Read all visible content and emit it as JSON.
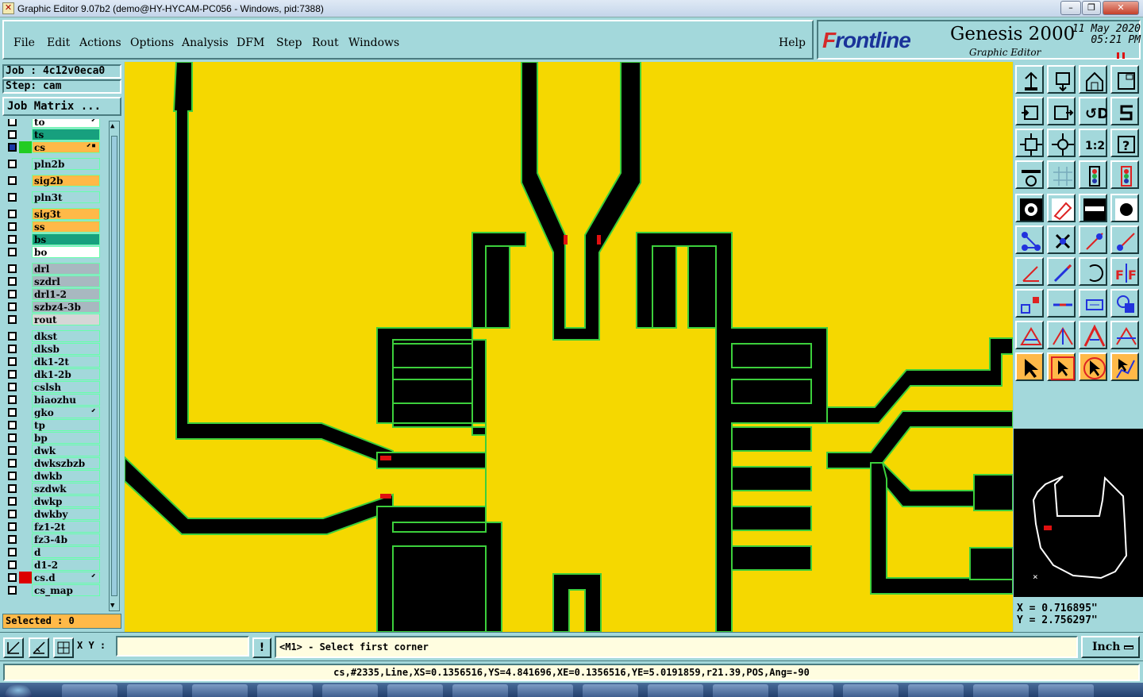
{
  "window": {
    "title": "Graphic Editor 9.07b2 (demo@HY-HYCAM-PC056 - Windows, pid:7388)",
    "controls": [
      "–",
      "❐",
      "✕"
    ]
  },
  "menu": {
    "items": [
      {
        "label": "File"
      },
      {
        "label": "Edit"
      },
      {
        "label": "Actions"
      },
      {
        "label": "Options"
      },
      {
        "label": "Analysis"
      },
      {
        "label": "DFM"
      },
      {
        "label": "Step"
      },
      {
        "label": "Rout"
      },
      {
        "label": "Windows"
      }
    ],
    "help": "Help"
  },
  "brand": {
    "logo_prefix": "F",
    "logo_rest": "rontline",
    "product": "Genesis 2000",
    "subtitle": "Graphic Editor",
    "date": "11 May 2020",
    "time": "05:21 PM"
  },
  "job": {
    "job_label": "Job  : 4c12v0eca0",
    "step_label": "Step: cam",
    "matrix_button": "Job Matrix ..."
  },
  "layers": [
    {
      "name": "to",
      "bg": "#ffffff",
      "flag": "⬋"
    },
    {
      "name": "ts",
      "bg": "#17a07e",
      "flag": ""
    },
    {
      "name": "cs",
      "bg": "#ffb948",
      "flag": "⬋▪",
      "color": "#22cc22",
      "selected": true
    },
    {
      "name": "pln2b",
      "bg": "#a3d8db",
      "flag": ""
    },
    {
      "name": "sig2b",
      "bg": "#ffb948",
      "flag": ""
    },
    {
      "name": "pln3t",
      "bg": "#a3d8db",
      "flag": ""
    },
    {
      "name": "sig3t",
      "bg": "#ffb948",
      "flag": ""
    },
    {
      "name": "ss",
      "bg": "#ffb948",
      "flag": ""
    },
    {
      "name": "bs",
      "bg": "#17a07e",
      "flag": ""
    },
    {
      "name": "bo",
      "bg": "#ffffff",
      "flag": ""
    },
    {
      "name": "drl",
      "bg": "#a8b8c0",
      "flag": ""
    },
    {
      "name": "szdrl",
      "bg": "#a8b8c0",
      "flag": ""
    },
    {
      "name": "drl1-2",
      "bg": "#a8b8c0",
      "flag": ""
    },
    {
      "name": "szbz4-3b",
      "bg": "#a8b8c0",
      "flag": ""
    },
    {
      "name": "rout",
      "bg": "#d6d6d6",
      "flag": ""
    },
    {
      "name": "dkst",
      "bg": "#a3d8db",
      "flag": ""
    },
    {
      "name": "dksb",
      "bg": "#a3d8db",
      "flag": ""
    },
    {
      "name": "dk1-2t",
      "bg": "#a3d8db",
      "flag": ""
    },
    {
      "name": "dk1-2b",
      "bg": "#a3d8db",
      "flag": ""
    },
    {
      "name": "cslsh",
      "bg": "#a3d8db",
      "flag": ""
    },
    {
      "name": "biaozhu",
      "bg": "#a3d8db",
      "flag": ""
    },
    {
      "name": "gko",
      "bg": "#a3d8db",
      "flag": "⬋"
    },
    {
      "name": "tp",
      "bg": "#a3d8db",
      "flag": ""
    },
    {
      "name": "bp",
      "bg": "#a3d8db",
      "flag": ""
    },
    {
      "name": "dwk",
      "bg": "#a3d8db",
      "flag": ""
    },
    {
      "name": "dwkszbzb",
      "bg": "#a3d8db",
      "flag": ""
    },
    {
      "name": "dwkb",
      "bg": "#a3d8db",
      "flag": ""
    },
    {
      "name": "szdwk",
      "bg": "#a3d8db",
      "flag": ""
    },
    {
      "name": "dwkp",
      "bg": "#a3d8db",
      "flag": ""
    },
    {
      "name": "dwkby",
      "bg": "#a3d8db",
      "flag": ""
    },
    {
      "name": "fz1-2t",
      "bg": "#a3d8db",
      "flag": ""
    },
    {
      "name": "fz3-4b",
      "bg": "#a3d8db",
      "flag": ""
    },
    {
      "name": "d",
      "bg": "#a3d8db",
      "flag": ""
    },
    {
      "name": "d1-2",
      "bg": "#a3d8db",
      "flag": ""
    },
    {
      "name": "cs.d",
      "bg": "#a3d8db",
      "flag": "⬋",
      "color": "#dd0000"
    },
    {
      "name": "cs_map",
      "bg": "#a3d8db",
      "flag": ""
    }
  ],
  "selected_label": "Selected : 0",
  "coords": {
    "x": "X = 0.716895\"",
    "y": "Y = 2.756297\""
  },
  "command": {
    "xy_label": "X Y :",
    "xy_value": "",
    "prompt": "<M1> - Select first corner",
    "unit": "Inch"
  },
  "status_text": "cs,#2335,Line,XS=0.1356516,YS=4.841696,XE=0.1356516,YE=5.0191859,r21.39,POS,Ang=-90",
  "colors": {
    "background_panel": "#a3d8db",
    "copper": "#f5d800",
    "clearance": "#000000",
    "outline": "#3ccf3c",
    "highlight": "#e01010"
  },
  "toolbar": {
    "icons": [
      "home-view-icon",
      "page-down-icon",
      "house-icon",
      "window-icon",
      "zoom-back-icon",
      "zoom-forward-icon",
      "rotate-mirror-icon",
      "s-shape-icon",
      "pan-fit-icon",
      "pan-center-icon",
      "scale-1-2-icon",
      "help-question-icon",
      "snap-icon",
      "grid-icon",
      "traffic-light-icon",
      "traffic-light-red-icon",
      "pad-select-icon",
      "draw-shape-icon",
      "measure-ruler-icon",
      "dot-icon",
      "net-connect-icon",
      "cross-icon",
      "line-vertex-icon",
      "line-endpoint-icon",
      "angle-icon",
      "diagonal-line-icon",
      "arc-icon",
      "flip-icon",
      "pad-move-icon",
      "line-split-icon",
      "dimension-icon",
      "shapes-icon",
      "triangle-red-icon",
      "triangle-blue-icon",
      "triangle-arrow-icon",
      "triangle-flat-icon",
      "pointer-icon",
      "pointer-box-icon",
      "pointer-circle-icon",
      "pointer-path-icon"
    ]
  }
}
